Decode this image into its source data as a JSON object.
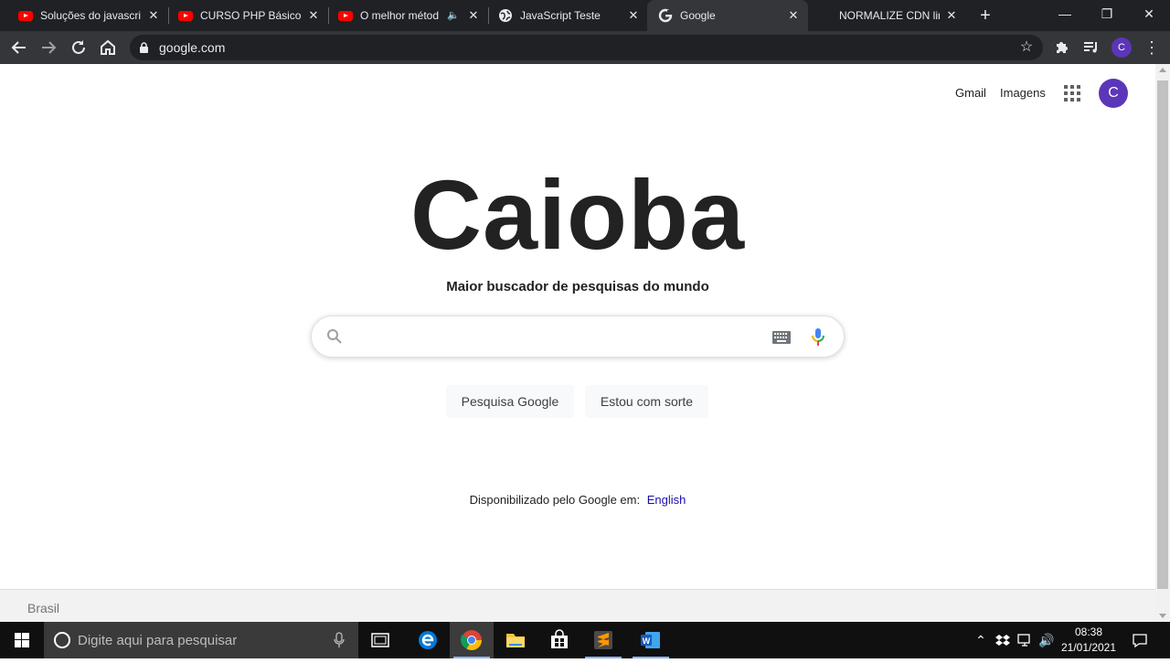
{
  "browser": {
    "tabs": [
      {
        "title": "Soluções do javascrip",
        "icon": "youtube-icon",
        "active": false
      },
      {
        "title": "CURSO PHP Básico -",
        "icon": "youtube-icon",
        "active": false
      },
      {
        "title": "O melhor métod",
        "icon": "youtube-icon",
        "active": false,
        "audio": true
      },
      {
        "title": "JavaScript Teste",
        "icon": "globe-icon",
        "active": false
      },
      {
        "title": "Google",
        "icon": "google-icon",
        "active": true
      },
      {
        "title": "NORMALIZE CDN lin",
        "icon": "none",
        "active": false
      }
    ],
    "new_tab": "+",
    "url": "google.com",
    "profile_initial": "C"
  },
  "page": {
    "top_links": {
      "gmail": "Gmail",
      "images": "Imagens"
    },
    "avatar_initial": "C",
    "logo": "Caioba",
    "tagline": "Maior buscador de pesquisas do mundo",
    "search": {
      "value": "",
      "placeholder": ""
    },
    "buttons": {
      "search": "Pesquisa Google",
      "lucky": "Estou com sorte"
    },
    "language": {
      "text": "Disponibilizado pelo Google em:",
      "link": "English"
    },
    "footer": "Brasil"
  },
  "taskbar": {
    "search_placeholder": "Digite aqui para pesquisar",
    "time": "08:38",
    "date": "21/01/2021"
  },
  "colors": {
    "chrome_dark": "#202124",
    "toolbar": "#35363a",
    "avatar": "#5b36b8",
    "link": "#1a0dab"
  }
}
